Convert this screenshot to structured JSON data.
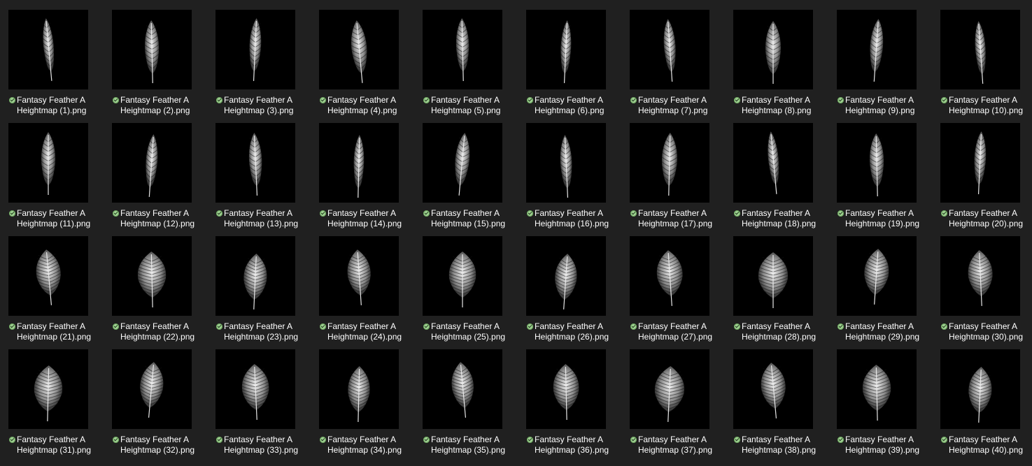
{
  "colors": {
    "background": "#202020",
    "thumbnail_background": "#000000",
    "label_text": "#ffffff",
    "status_check": "#9fcf92"
  },
  "icons": {
    "status": "synced-check-icon"
  },
  "files": [
    {
      "line1": "Fantasy Feather A",
      "line2": "Heightmap (1).png"
    },
    {
      "line1": "Fantasy Feather A",
      "line2": "Heightmap (2).png"
    },
    {
      "line1": "Fantasy Feather A",
      "line2": "Heightmap (3).png"
    },
    {
      "line1": "Fantasy Feather A",
      "line2": "Heightmap (4).png"
    },
    {
      "line1": "Fantasy Feather A",
      "line2": "Heightmap (5).png"
    },
    {
      "line1": "Fantasy Feather A",
      "line2": "Heightmap (6).png"
    },
    {
      "line1": "Fantasy Feather A",
      "line2": "Heightmap (7).png"
    },
    {
      "line1": "Fantasy Feather A",
      "line2": "Heightmap (8).png"
    },
    {
      "line1": "Fantasy Feather A",
      "line2": "Heightmap (9).png"
    },
    {
      "line1": "Fantasy Feather A",
      "line2": "Heightmap (10).png"
    },
    {
      "line1": "Fantasy Feather A",
      "line2": "Heightmap (11).png"
    },
    {
      "line1": "Fantasy Feather A",
      "line2": "Heightmap (12).png"
    },
    {
      "line1": "Fantasy Feather A",
      "line2": "Heightmap (13).png"
    },
    {
      "line1": "Fantasy Feather A",
      "line2": "Heightmap (14).png"
    },
    {
      "line1": "Fantasy Feather A",
      "line2": "Heightmap (15).png"
    },
    {
      "line1": "Fantasy Feather A",
      "line2": "Heightmap (16).png"
    },
    {
      "line1": "Fantasy Feather A",
      "line2": "Heightmap (17).png"
    },
    {
      "line1": "Fantasy Feather A",
      "line2": "Heightmap (18).png"
    },
    {
      "line1": "Fantasy Feather A",
      "line2": "Heightmap (19).png"
    },
    {
      "line1": "Fantasy Feather A",
      "line2": "Heightmap (20).png"
    },
    {
      "line1": "Fantasy Feather A",
      "line2": "Heightmap (21).png"
    },
    {
      "line1": "Fantasy Feather A",
      "line2": "Heightmap (22).png"
    },
    {
      "line1": "Fantasy Feather A",
      "line2": "Heightmap (23).png"
    },
    {
      "line1": "Fantasy Feather A",
      "line2": "Heightmap (24).png"
    },
    {
      "line1": "Fantasy Feather A",
      "line2": "Heightmap (25).png"
    },
    {
      "line1": "Fantasy Feather A",
      "line2": "Heightmap (26).png"
    },
    {
      "line1": "Fantasy Feather A",
      "line2": "Heightmap (27).png"
    },
    {
      "line1": "Fantasy Feather A",
      "line2": "Heightmap (28).png"
    },
    {
      "line1": "Fantasy Feather A",
      "line2": "Heightmap (29).png"
    },
    {
      "line1": "Fantasy Feather A",
      "line2": "Heightmap (30).png"
    },
    {
      "line1": "Fantasy Feather A",
      "line2": "Heightmap (31).png"
    },
    {
      "line1": "Fantasy Feather A",
      "line2": "Heightmap (32).png"
    },
    {
      "line1": "Fantasy Feather A",
      "line2": "Heightmap (33).png"
    },
    {
      "line1": "Fantasy Feather A",
      "line2": "Heightmap (34).png"
    },
    {
      "line1": "Fantasy Feather A",
      "line2": "Heightmap (35).png"
    },
    {
      "line1": "Fantasy Feather A",
      "line2": "Heightmap (36).png"
    },
    {
      "line1": "Fantasy Feather A",
      "line2": "Heightmap (37).png"
    },
    {
      "line1": "Fantasy Feather A",
      "line2": "Heightmap (38).png"
    },
    {
      "line1": "Fantasy Feather A",
      "line2": "Heightmap (39).png"
    },
    {
      "line1": "Fantasy Feather A",
      "line2": "Heightmap (40).png"
    }
  ]
}
